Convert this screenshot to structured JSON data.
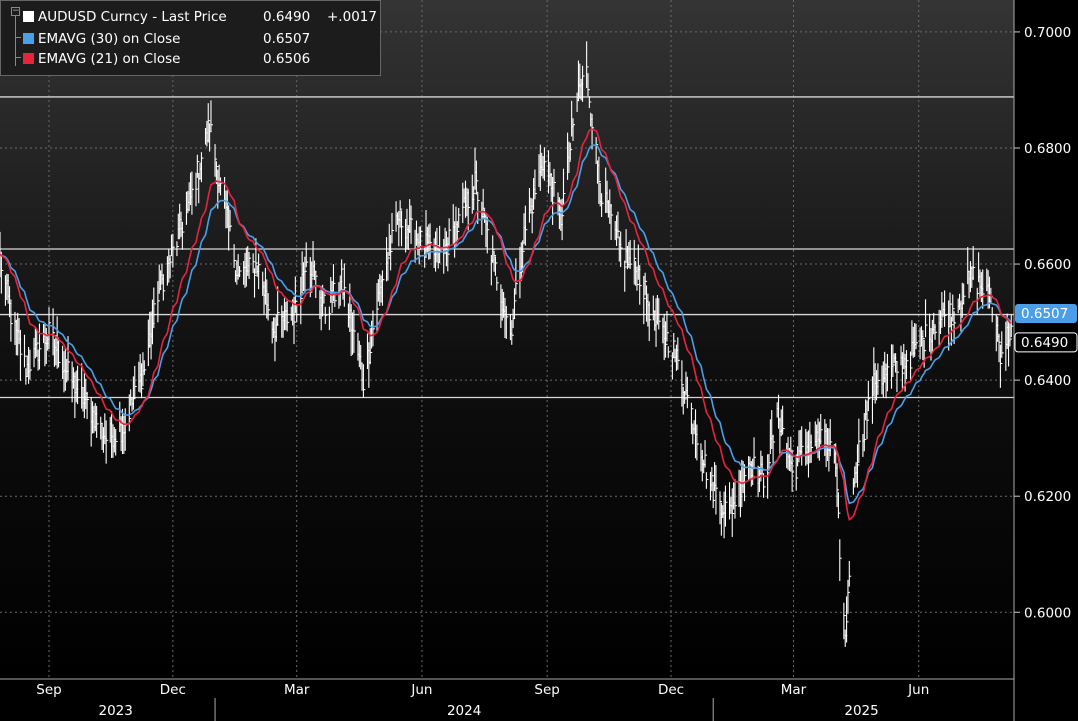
{
  "legend": {
    "row1_name": "AUDUSD Curncy - Last Price",
    "row1_value": "0.6490",
    "row1_change": "+.0017",
    "row2_name": "EMAVG (30)  on Close",
    "row2_value": "0.6507",
    "row3_name": "EMAVG (21)  on Close",
    "row3_value": "0.6506"
  },
  "colors": {
    "background": "#000000",
    "price": "#ffffff",
    "ema30": "#4a9fe8",
    "ema21": "#e8233c",
    "grid": "#6a6a6a",
    "hline": "#d8d8d8",
    "axis_text": "#ffffff"
  },
  "chart_data": {
    "type": "line",
    "title": "",
    "y_ticks": [
      "0.7000",
      "0.6800",
      "0.6600",
      "0.6400",
      "0.6200",
      "0.6000"
    ],
    "ylim": [
      0.5885,
      0.7055
    ],
    "x_month_labels": [
      "Sep",
      "Dec",
      "Mar",
      "Jun",
      "Sep",
      "Dec",
      "Mar",
      "Jun"
    ],
    "x_year_labels": [
      "2023",
      "2024",
      "2025"
    ],
    "x_range": [
      "2023-07-27",
      "2025-08-10"
    ],
    "horizontal_levels": [
      0.6888,
      0.6626,
      0.6513,
      0.637
    ],
    "last_value_labels": [
      {
        "value": 0.6507,
        "text": "0.6507",
        "series": "EMAVG (30)  on Close"
      },
      {
        "value": 0.649,
        "text": "0.6490",
        "series": "AUDUSD Curncy - Last Price"
      }
    ],
    "price_keypoints": [
      [
        "2023-07-27",
        0.661
      ],
      [
        "2023-08-05",
        0.65
      ],
      [
        "2023-08-15",
        0.642
      ],
      [
        "2023-09-01",
        0.648
      ],
      [
        "2023-09-15",
        0.641
      ],
      [
        "2023-10-01",
        0.635
      ],
      [
        "2023-10-13",
        0.63
      ],
      [
        "2023-10-26",
        0.632
      ],
      [
        "2023-11-10",
        0.642
      ],
      [
        "2023-11-20",
        0.655
      ],
      [
        "2023-12-04",
        0.664
      ],
      [
        "2023-12-15",
        0.672
      ],
      [
        "2023-12-28",
        0.684
      ],
      [
        "2024-01-05",
        0.673
      ],
      [
        "2024-01-18",
        0.658
      ],
      [
        "2024-02-01",
        0.66
      ],
      [
        "2024-02-13",
        0.649
      ],
      [
        "2024-03-01",
        0.652
      ],
      [
        "2024-03-08",
        0.662
      ],
      [
        "2024-03-22",
        0.652
      ],
      [
        "2024-04-03",
        0.657
      ],
      [
        "2024-04-19",
        0.64
      ],
      [
        "2024-05-03",
        0.658
      ],
      [
        "2024-05-15",
        0.668
      ],
      [
        "2024-05-30",
        0.664
      ],
      [
        "2024-06-14",
        0.661
      ],
      [
        "2024-06-28",
        0.667
      ],
      [
        "2024-07-10",
        0.674
      ],
      [
        "2024-07-19",
        0.665
      ],
      [
        "2024-08-05",
        0.648
      ],
      [
        "2024-08-15",
        0.665
      ],
      [
        "2024-08-29",
        0.678
      ],
      [
        "2024-09-11",
        0.668
      ],
      [
        "2024-09-24",
        0.69
      ],
      [
        "2024-09-30",
        0.693
      ],
      [
        "2024-10-10",
        0.673
      ],
      [
        "2024-10-25",
        0.662
      ],
      [
        "2024-11-08",
        0.658
      ],
      [
        "2024-11-18",
        0.65
      ],
      [
        "2024-12-02",
        0.646
      ],
      [
        "2024-12-13",
        0.637
      ],
      [
        "2024-12-30",
        0.622
      ],
      [
        "2025-01-13",
        0.617
      ],
      [
        "2025-01-27",
        0.626
      ],
      [
        "2025-02-07",
        0.623
      ],
      [
        "2025-02-18",
        0.634
      ],
      [
        "2025-02-28",
        0.624
      ],
      [
        "2025-03-12",
        0.629
      ],
      [
        "2025-03-21",
        0.63
      ],
      [
        "2025-03-31",
        0.627
      ],
      [
        "2025-04-08",
        0.595
      ],
      [
        "2025-04-15",
        0.625
      ],
      [
        "2025-04-30",
        0.64
      ],
      [
        "2025-05-15",
        0.642
      ],
      [
        "2025-05-30",
        0.645
      ],
      [
        "2025-06-13",
        0.65
      ],
      [
        "2025-06-27",
        0.652
      ],
      [
        "2025-07-10",
        0.658
      ],
      [
        "2025-07-24",
        0.654
      ],
      [
        "2025-07-31",
        0.645
      ],
      [
        "2025-08-08",
        0.649
      ]
    ],
    "series": [
      {
        "name": "AUDUSD Curncy - Last Price",
        "style": "daily high-low bars"
      },
      {
        "name": "EMAVG (30)  on Close",
        "style": "line"
      },
      {
        "name": "EMAVG (21)  on Close",
        "style": "line"
      }
    ],
    "grid": true,
    "legend_position": "top-left"
  }
}
